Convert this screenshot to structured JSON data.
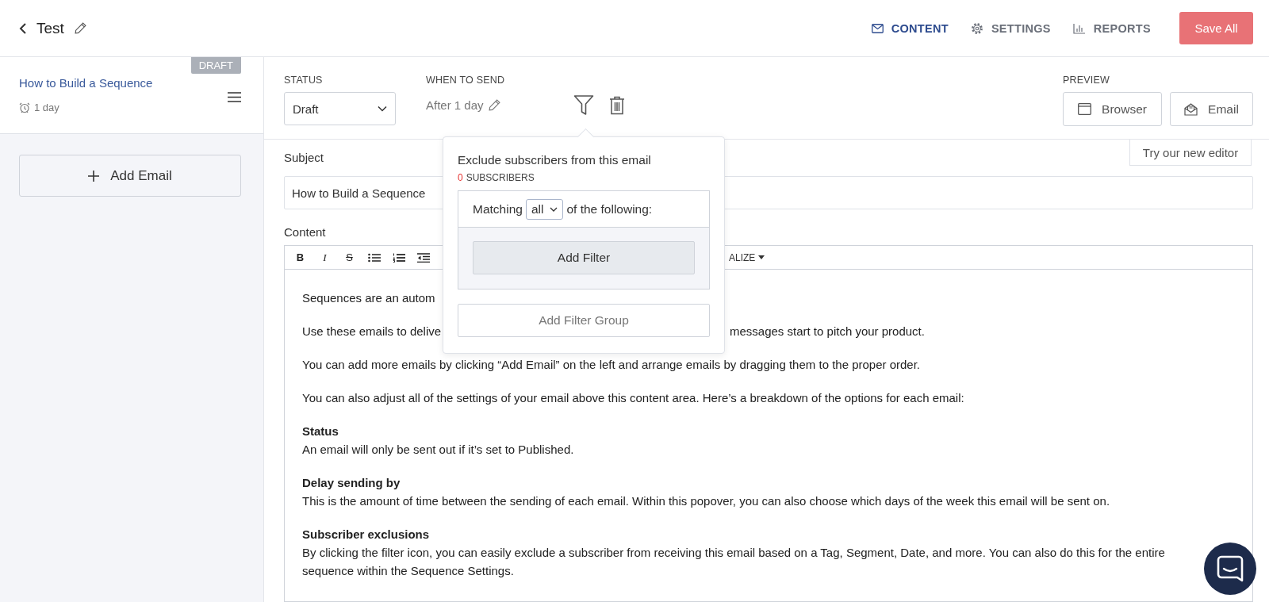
{
  "header": {
    "title": "Test",
    "nav": [
      {
        "label": "CONTENT",
        "selected": true
      },
      {
        "label": "SETTINGS",
        "selected": false
      },
      {
        "label": "REPORTS",
        "selected": false
      }
    ],
    "save_button": "Save All"
  },
  "sidebar": {
    "emails": [
      {
        "status": "DRAFT",
        "title": "How to Build a Sequence",
        "delay": "1 day"
      }
    ],
    "add_button": "Add Email"
  },
  "settings": {
    "status": {
      "label": "STATUS",
      "value": "Draft"
    },
    "when_to_send": {
      "label": "WHEN TO SEND",
      "value": "After 1 day"
    },
    "preview": {
      "label": "PREVIEW",
      "buttons": [
        {
          "label": "Browser"
        },
        {
          "label": "Email"
        }
      ]
    }
  },
  "editor": {
    "new_editor_button": "Try our new editor",
    "subject": {
      "label": "Subject",
      "value": "How to Build a Sequence"
    },
    "content_label": "Content",
    "toolbar": [
      {
        "kind": "bold",
        "label": "B"
      },
      {
        "kind": "italic",
        "label": "I"
      },
      {
        "kind": "strike",
        "label": "S"
      },
      {
        "kind": "bullets"
      },
      {
        "kind": "numbers"
      },
      {
        "kind": "outdent"
      }
    ],
    "personalize": "ALIZE",
    "paragraphs": [
      {
        "parts": [
          "Sequences are an autom"
        ]
      },
      {
        "parts": [
          "Use these emails to delive",
          "messages start to pitch your product."
        ]
      },
      {
        "text": "You can add more emails by clicking “Add Email” on the left and arrange emails by dragging them to the proper order."
      },
      {
        "text": "You can also adjust all of the settings of your email above this content area. Here’s a breakdown of the options for each email:"
      },
      {
        "heading": "Status",
        "text": "An email will only be sent out if it’s set to Published."
      },
      {
        "heading": "Delay sending by",
        "text": "This is the amount of time between the sending of each email. Within this popover, you can also choose which days of the week this email will be sent on."
      },
      {
        "heading": "Subscriber exclusions",
        "text": "By clicking the filter icon, you can easily exclude a subscriber from receiving this email based on a Tag, Segment, Date, and more. You can also do this for the entire sequence within the Sequence Settings."
      }
    ]
  },
  "popover": {
    "title": "Exclude subscribers from this email",
    "count": "0",
    "count_label": "SUBSCRIBERS",
    "matching_prefix": "Matching",
    "matching_value": "all",
    "matching_suffix": "of the following:",
    "add_filter": "Add Filter",
    "add_filter_group": "Add Filter Group"
  }
}
